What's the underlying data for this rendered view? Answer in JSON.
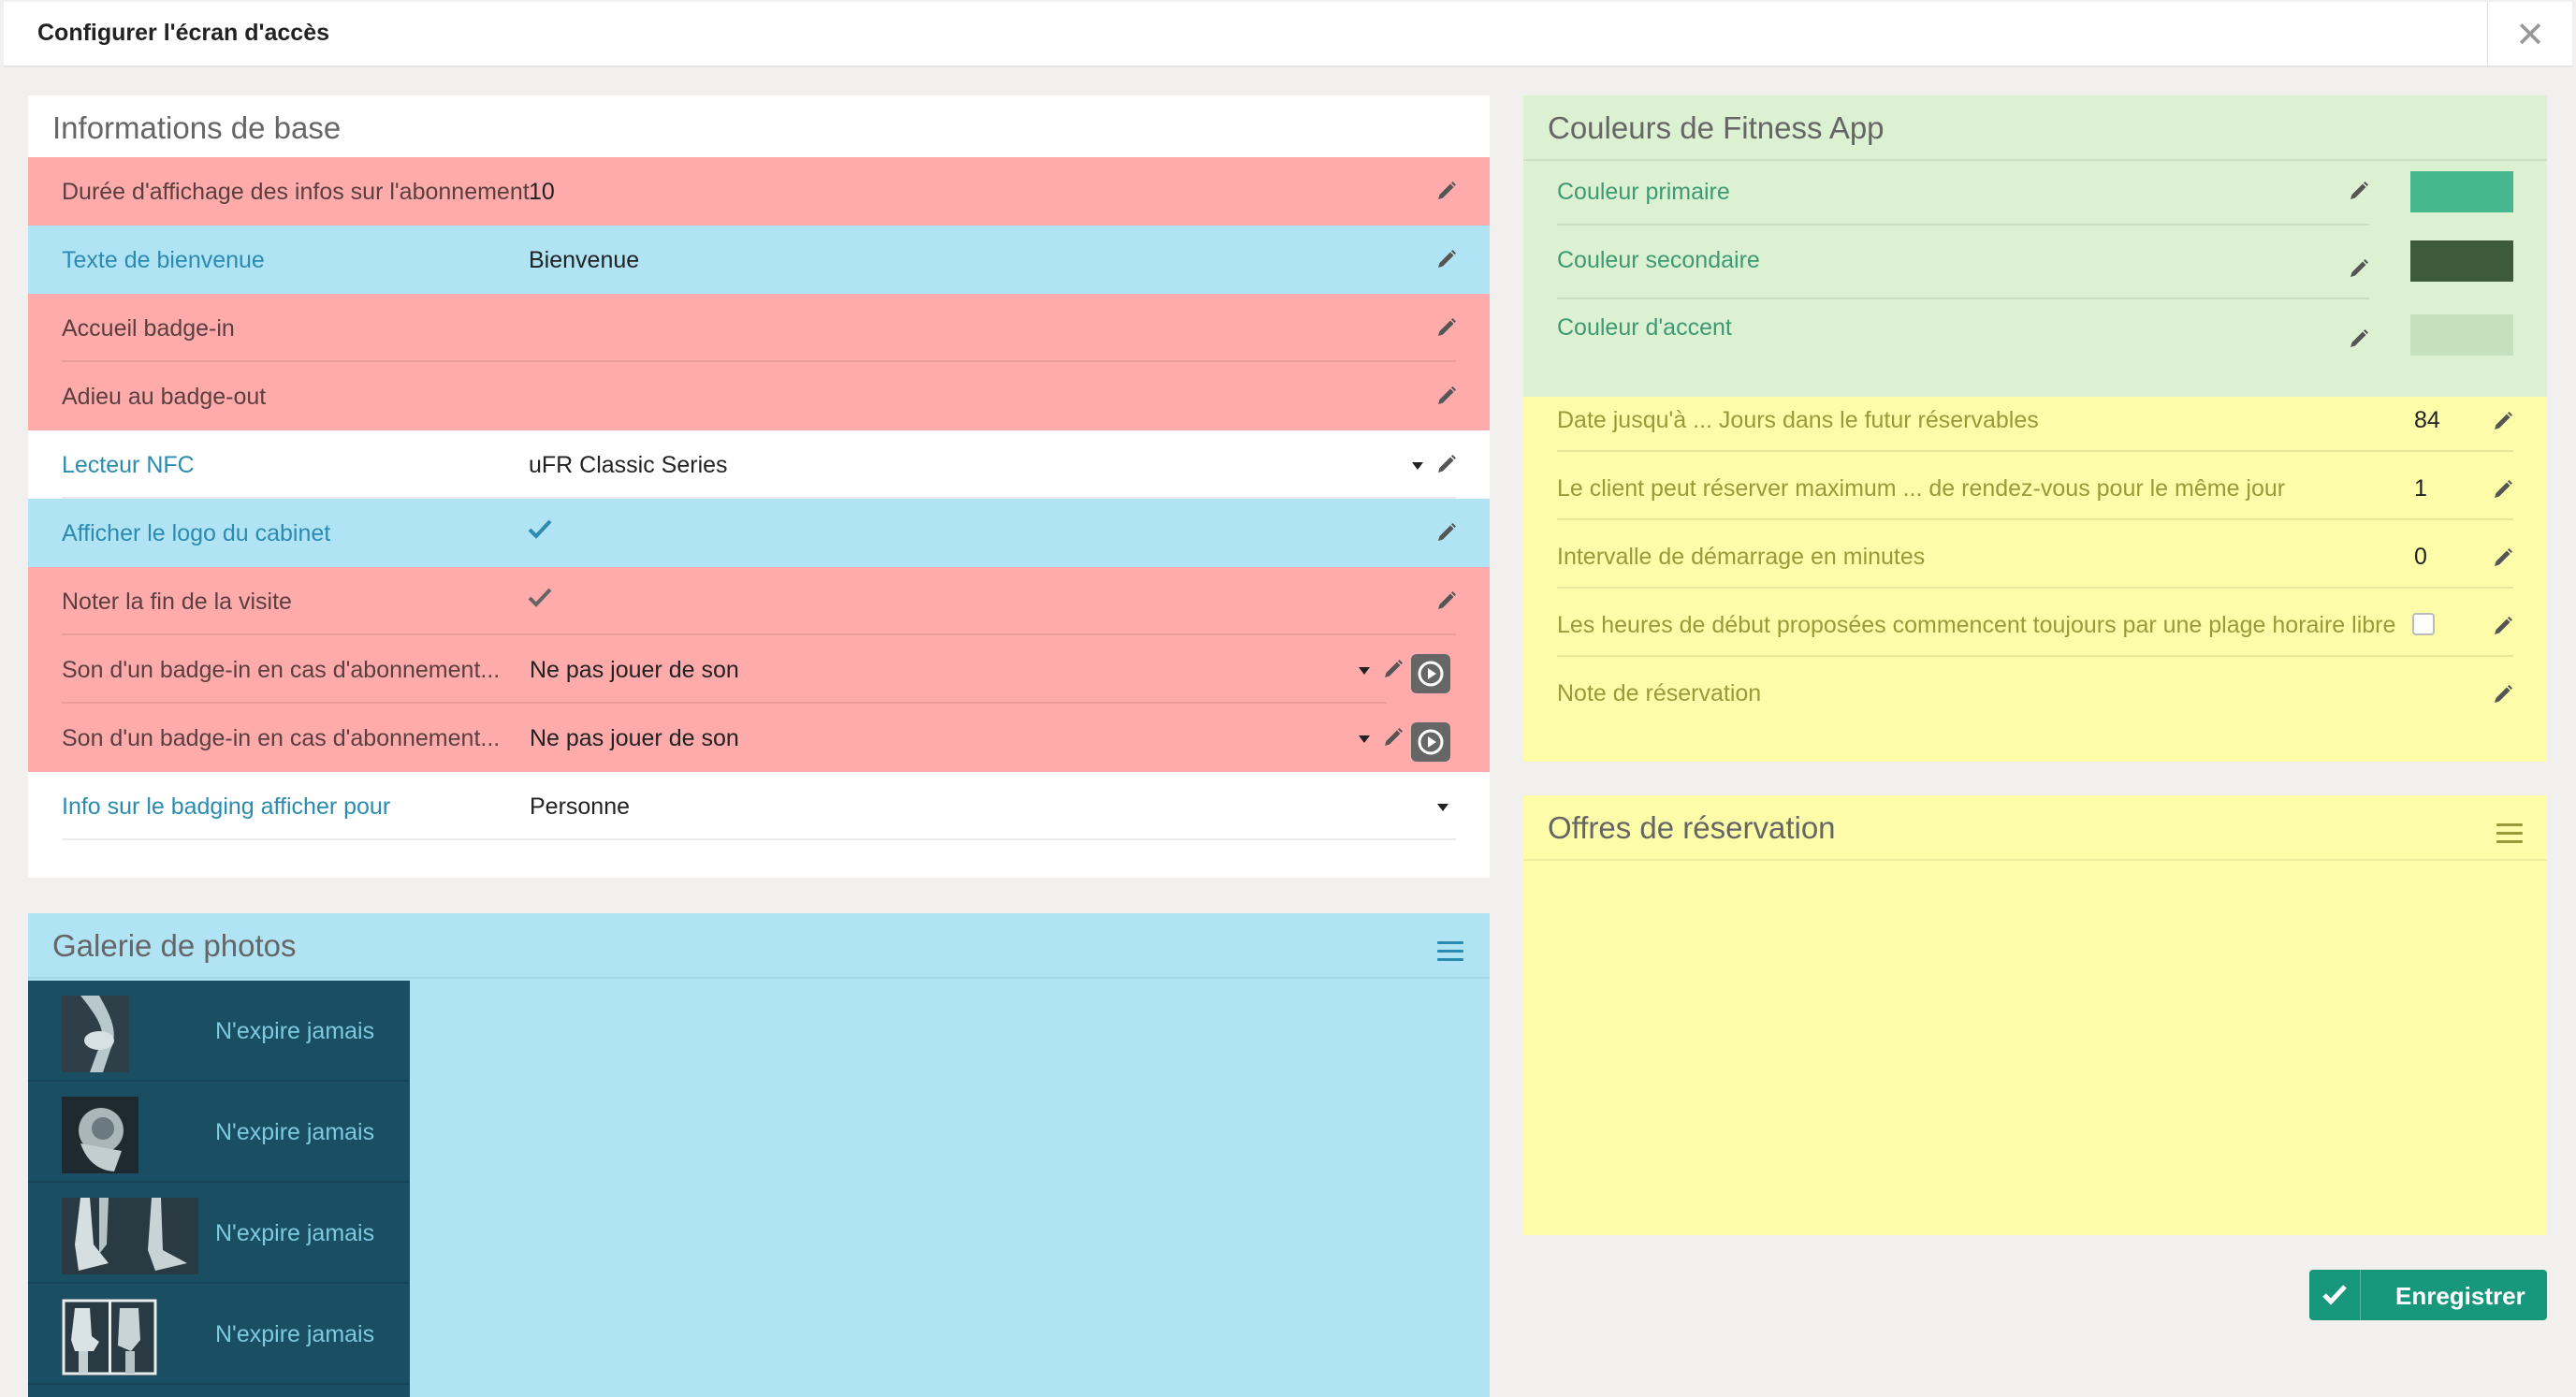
{
  "dialog": {
    "title": "Configurer l'écran d'accès",
    "close_glyph": "✕"
  },
  "basic_info": {
    "title": "Informations de base",
    "rows": [
      {
        "label": "Durée d'affichage des infos sur l'abonnement",
        "value": "10"
      },
      {
        "label": "Texte de bienvenue",
        "value": "Bienvenue"
      },
      {
        "label": "Accueil badge-in",
        "value": ""
      },
      {
        "label": "Adieu au badge-out",
        "value": ""
      },
      {
        "label": "Lecteur NFC",
        "value": "uFR Classic Series"
      },
      {
        "label": "Afficher le logo du cabinet",
        "checked": true
      },
      {
        "label": "Noter la fin de la visite",
        "checked": true
      },
      {
        "label": "Son d'un badge-in en cas d'abonnement...",
        "value": "Ne pas jouer de son"
      },
      {
        "label": "Son d'un badge-in en cas d'abonnement...",
        "value": "Ne pas jouer de son"
      },
      {
        "label": "Info sur le badging afficher pour",
        "value": "Personne"
      }
    ]
  },
  "gallery": {
    "title": "Galerie de photos",
    "items": [
      {
        "expiry": "N'expire jamais"
      },
      {
        "expiry": "N'expire jamais"
      },
      {
        "expiry": "N'expire jamais"
      },
      {
        "expiry": "N'expire jamais"
      }
    ]
  },
  "colors": {
    "title": "Couleurs de Fitness App",
    "rows": [
      {
        "label": "Couleur primaire",
        "color": "#46b88f"
      },
      {
        "label": "Couleur secondaire",
        "color": "#3d5a3a"
      },
      {
        "label": "Couleur d'accent",
        "color": "#c6e0bd"
      }
    ]
  },
  "booking": {
    "rows": [
      {
        "label": "Date jusqu'à ... Jours dans le futur réservables",
        "value": "84"
      },
      {
        "label": "Le client peut réserver maximum ... de rendez-vous pour le même jour",
        "value": "1"
      },
      {
        "label": "Intervalle de démarrage en minutes",
        "value": "0"
      },
      {
        "label": "Les heures de début proposées commencent toujours par une plage horaire libre",
        "checked": false
      },
      {
        "label": "Note de réservation",
        "value": ""
      }
    ]
  },
  "offers": {
    "title": "Offres de réservation"
  },
  "save_button": {
    "label": "Enregistrer"
  },
  "theme": {
    "red_row": "#ffabab",
    "blue_row": "#b0e3f4",
    "green_panel": "#dcf0d2",
    "yellow_panel": "#fdfca8",
    "gallery_dark": "#1a4f63",
    "save_green": "#17987d"
  }
}
